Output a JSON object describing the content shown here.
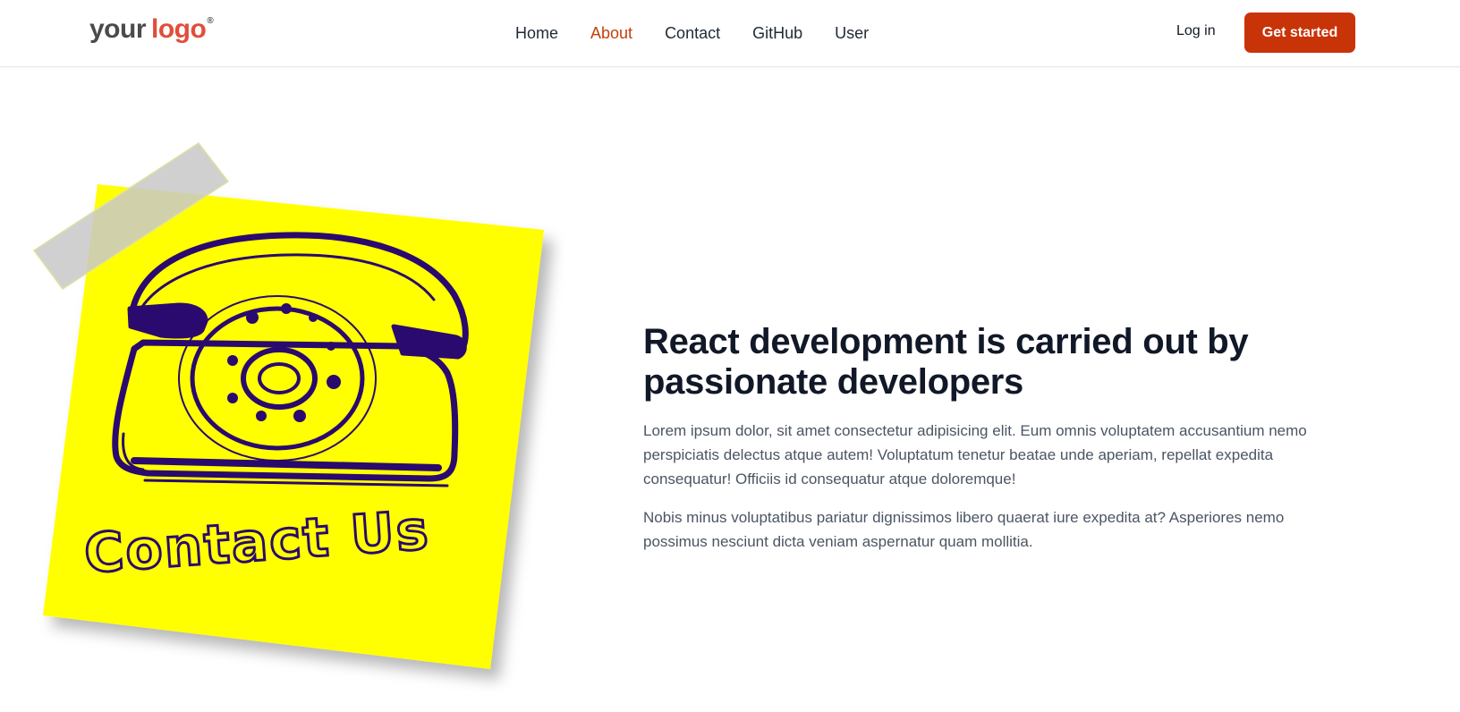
{
  "header": {
    "logo": {
      "word1": "your",
      "word2": "logo",
      "mark": "®"
    },
    "nav": [
      {
        "label": "Home",
        "active": false
      },
      {
        "label": "About",
        "active": true
      },
      {
        "label": "Contact",
        "active": false
      },
      {
        "label": "GitHub",
        "active": false
      },
      {
        "label": "User",
        "active": false
      }
    ],
    "login_label": "Log in",
    "cta_label": "Get started"
  },
  "hero": {
    "note_text": "Contact Us",
    "title": "React development is carried out by passionate developers",
    "paragraphs": [
      "Lorem ipsum dolor, sit amet consectetur adipisicing elit. Eum omnis voluptatem accusantium nemo perspiciatis delectus atque autem! Voluptatum tenetur beatae unde aperiam, repellat expedita consequatur! Officiis id consequatur atque doloremque!",
      "Nobis minus voluptatibus pariatur dignissimos libero quaerat iure expedita at? Asperiores nemo possimus nesciunt dicta veniam aspernatur quam mollitia."
    ]
  },
  "colors": {
    "accent": "#c93308",
    "active_nav": "#c2410c",
    "note_yellow": "#ffff00",
    "ink_purple": "#2a0a6e"
  }
}
